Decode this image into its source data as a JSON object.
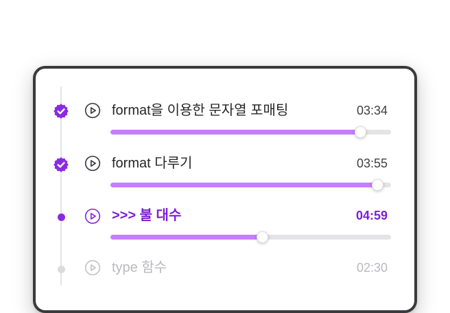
{
  "colors": {
    "accent": "#8a2be2",
    "progress": "#c77dff",
    "track": "#e4e4e7",
    "text": "#262626",
    "muted": "#b9b9bf"
  },
  "lessons": [
    {
      "title": "format을 이용한 문자열 포매팅",
      "duration": "03:34",
      "status": "completed",
      "status_icon": "verified-check-icon",
      "progress": 0.89
    },
    {
      "title": "format 다루기",
      "duration": "03:55",
      "status": "completed",
      "status_icon": "verified-check-icon",
      "progress": 0.95
    },
    {
      "title": ">>> 불 대수",
      "duration": "04:59",
      "status": "current",
      "status_icon": "current-dot-icon",
      "progress": 0.54
    },
    {
      "title": "type 함수",
      "duration": "02:30",
      "status": "upcoming",
      "status_icon": "pending-dot-icon",
      "progress": 0
    }
  ]
}
